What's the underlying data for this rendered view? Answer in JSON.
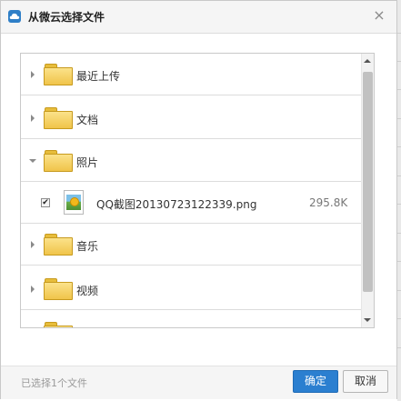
{
  "dialog": {
    "title": "从微云选择文件",
    "close_glyph": "×",
    "logo_icon": "weiyun-cloud-icon"
  },
  "tree": {
    "folders": [
      {
        "label": "最近上传",
        "expanded": false
      },
      {
        "label": "文档",
        "expanded": false
      },
      {
        "label": "照片",
        "expanded": true
      },
      {
        "label": "音乐",
        "expanded": false
      },
      {
        "label": "视频",
        "expanded": false
      },
      {
        "label": "",
        "expanded": false
      }
    ],
    "file": {
      "checked": true,
      "check_glyph": "✔",
      "name": "QQ截图20130723122339.png",
      "size": "295.8K"
    }
  },
  "footer": {
    "status": "已选择1个文件",
    "ok_label": "确定",
    "cancel_label": "取消"
  },
  "colors": {
    "accent": "#2b7fd0",
    "folder": "#f0c44a"
  }
}
